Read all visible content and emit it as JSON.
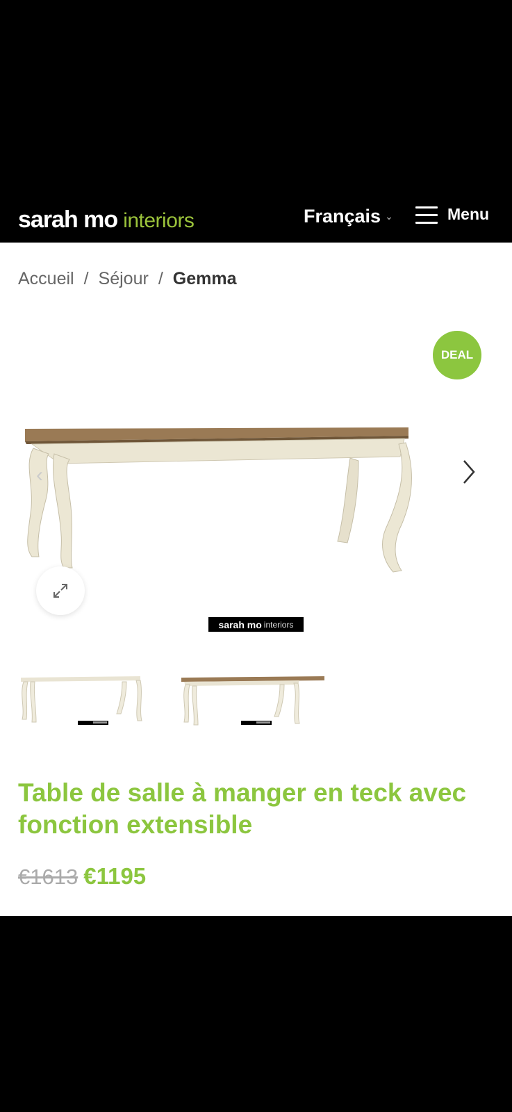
{
  "header": {
    "logo_bold": "sarah mo",
    "logo_light": "interiors",
    "language": "Français",
    "menu_label": "Menu"
  },
  "breadcrumb": {
    "items": [
      "Accueil",
      "Séjour"
    ],
    "current": "Gemma",
    "separator": "/"
  },
  "badge": {
    "label": "DEAL",
    "color": "#8cc63f"
  },
  "gallery": {
    "watermark_bold": "sarah mo",
    "watermark_light": "interiors",
    "icons": {
      "prev": "chevron-left-icon",
      "next": "chevron-right-icon",
      "zoom": "expand-icon"
    },
    "thumbnail_count": 2
  },
  "product": {
    "title": "Table de salle à manger en teck avec fonction extensible",
    "old_price": "€1613",
    "price": "€1195"
  },
  "colors": {
    "accent": "#8cc63f",
    "background": "#ffffff",
    "header": "#000000"
  }
}
